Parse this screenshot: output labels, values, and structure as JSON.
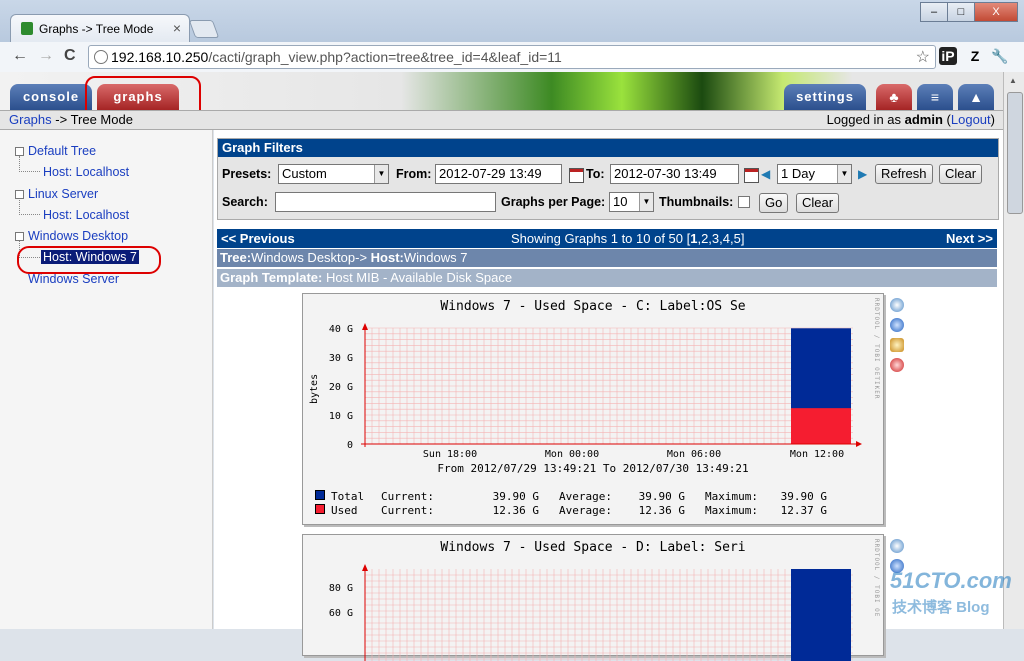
{
  "browser": {
    "tab_title": "Graphs -> Tree Mode",
    "tab_close": "×",
    "url_host": "192.168.10.250",
    "url_path": "/cacti/graph_view.php?action=tree&tree_id=4&leaf_id=11",
    "back": "←",
    "forward": "→",
    "reload": "C",
    "window_min": "–",
    "window_max": "□",
    "window_close": "X",
    "ext_ip": "iP",
    "ext_z": "Z",
    "ext_wrench": "🔧",
    "star": "☆"
  },
  "cacti": {
    "tabs": {
      "console": "console",
      "graphs": "graphs",
      "settings": "settings"
    },
    "icon_tabs": [
      "tree-view-icon",
      "list-view-icon",
      "preview-icon"
    ],
    "breadcrumb_link": "Graphs",
    "breadcrumb_sep": " -> ",
    "breadcrumb_current": "Tree Mode",
    "login_prefix": "Logged in as ",
    "login_user": "admin",
    "logout_open": " (",
    "logout": "Logout",
    "logout_close": ")"
  },
  "tree": {
    "items": [
      {
        "label": "Default Tree",
        "level": 0
      },
      {
        "label": "Host: Localhost",
        "level": 1
      },
      {
        "label": "Linux Server",
        "level": 0
      },
      {
        "label": "Host: Localhost",
        "level": 1
      },
      {
        "label": "Windows Desktop",
        "level": 0
      },
      {
        "label": "Host: Windows 7",
        "level": 1,
        "selected": true
      },
      {
        "label": "Windows Server",
        "level": 0
      }
    ]
  },
  "filters": {
    "heading": "Graph Filters",
    "presets_label": "Presets:",
    "presets_value": "Custom",
    "from_label": "From:",
    "from_value": "2012-07-29 13:49",
    "to_label": "To:",
    "to_value": "2012-07-30 13:49",
    "span_value": "1 Day",
    "refresh": "Refresh",
    "clear": "Clear",
    "search_label": "Search:",
    "search_value": "",
    "per_page_label": "Graphs per Page:",
    "per_page_value": "10",
    "thumbnails_label": "Thumbnails:",
    "go": "Go",
    "clear2": "Clear"
  },
  "pager": {
    "prev": "<< Previous",
    "showing": "Showing Graphs 1 to 10 of 50 [",
    "page_current": "1",
    "pages_rest": ",2,3,4,5]",
    "next": "Next >>"
  },
  "tree_row": {
    "tree_label": "Tree:",
    "tree_value": "Windows Desktop-> ",
    "host_label": "Host:",
    "host_value": "Windows 7"
  },
  "template_row": {
    "label": "Graph Template:",
    "value": " Host MIB - Available Disk Space"
  },
  "graphs": [
    {
      "title": "Windows 7 - Used Space - C: Label:OS  Se",
      "side_text": "RRDTOOL / TOBI OETIKER",
      "ylabel": "bytes",
      "yticks": [
        "40 G",
        "30 G",
        "20 G",
        "10 G",
        "0"
      ],
      "xticks": [
        "Sun 18:00",
        "Mon 00:00",
        "Mon 06:00",
        "Mon 12:00"
      ],
      "range": "From 2012/07/29 13:49:21 To 2012/07/30 13:49:21",
      "legend": [
        {
          "name": "Total",
          "current_label": "Current:",
          "current": "39.90 G",
          "avg_label": "Average:",
          "avg": "39.90 G",
          "max_label": "Maximum:",
          "max": "39.90 G",
          "color": "#002a97"
        },
        {
          "name": "Used",
          "current_label": "Current:",
          "current": "12.36 G",
          "avg_label": "Average:",
          "avg": "12.36 G",
          "max_label": "Maximum:",
          "max": "12.37 G",
          "color": "#f51d30"
        }
      ],
      "total_g": 39.9,
      "used_g": 12.36
    },
    {
      "title": "Windows 7 - Used Space - D: Label:  Seri",
      "side_text": "RRDTOOL / TOBI OE",
      "yticks": [
        "80 G",
        "60 G"
      ]
    }
  ],
  "watermark": {
    "line1": "51CTO.com",
    "line2": "技术博客 Blog"
  }
}
